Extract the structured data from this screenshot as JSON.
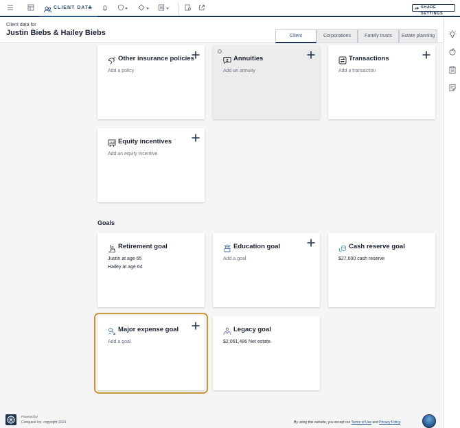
{
  "toolbar": {
    "tab_label": "CLIENT DATA",
    "share_label": "SHARE SETTINGS"
  },
  "header": {
    "client_for": "Client data for",
    "client_name": "Justin Biebs & Hailey Biebs",
    "tabs": [
      "Client",
      "Corporations",
      "Family trusts",
      "Estate planning"
    ],
    "active_tab": "Client"
  },
  "cards": {
    "other_insurance": {
      "title": "Other insurance policies",
      "sub": "Add a policy"
    },
    "annuities": {
      "title": "Annuities",
      "sub": "Add an annuity",
      "info": "!"
    },
    "transactions": {
      "title": "Transactions",
      "sub": "Add a transaction"
    },
    "equity": {
      "title": "Equity incentives",
      "sub": "Add an equity incentive"
    }
  },
  "goals": {
    "heading": "Goals",
    "retirement": {
      "title": "Retirement goal",
      "lines": [
        "Justin at age 65",
        "Hailey at age 64"
      ]
    },
    "education": {
      "title": "Education goal",
      "sub": "Add a goal"
    },
    "cash_reserve": {
      "title": "Cash reserve goal",
      "line": "$27,000 cash reserve"
    },
    "major_expense": {
      "title": "Major expense goal",
      "sub": "Add a goal"
    },
    "legacy": {
      "title": "Legacy goal",
      "line": "$2,061,486 Net estate"
    }
  },
  "footer": {
    "powered_by": "Powered by",
    "copyright": "Conquest Inc. copyright 2024",
    "terms_prefix": "By using this website, you accept our",
    "terms_link": "Terms of Use",
    "and": "and",
    "privacy_link": "Privacy Policy",
    "period": "."
  },
  "colors": {
    "navy": "#1c3250",
    "accent_border": "#c9973a",
    "link": "#1f4f85"
  }
}
